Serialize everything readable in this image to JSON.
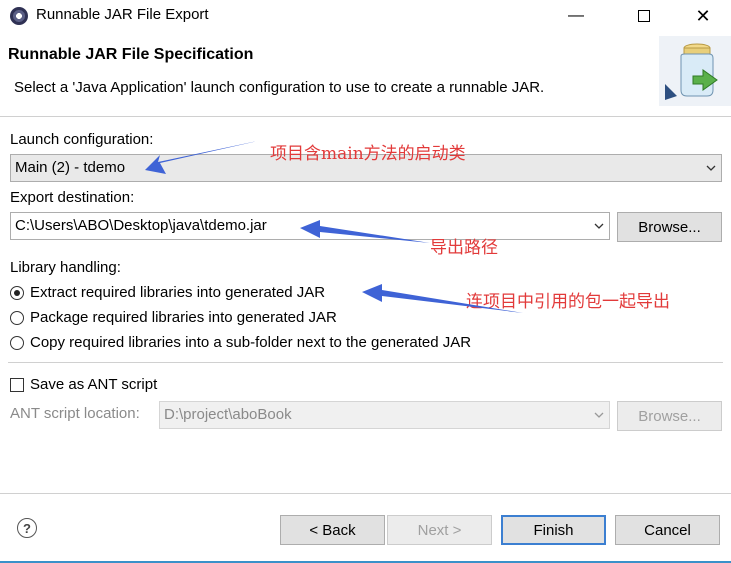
{
  "window": {
    "title": "Runnable JAR File Export",
    "minimize_icon": "minimize-icon",
    "maximize_icon": "maximize-icon",
    "close_icon": "close-icon"
  },
  "header": {
    "title": "Runnable JAR File Specification",
    "description": "Select a 'Java Application' launch configuration to use to create a runnable JAR."
  },
  "launch": {
    "label": "Launch configuration:",
    "value": "Main (2) - tdemo"
  },
  "export": {
    "label": "Export destination:",
    "value": "C:\\Users\\ABO\\Desktop\\java\\tdemo.jar",
    "browse_label": "Browse..."
  },
  "library": {
    "label": "Library handling:",
    "options": [
      {
        "label": "Extract required libraries into generated JAR",
        "selected": true
      },
      {
        "label": "Package required libraries into generated JAR",
        "selected": false
      },
      {
        "label": "Copy required libraries into a sub-folder next to the generated JAR",
        "selected": false
      }
    ]
  },
  "ant": {
    "checkbox_label": "Save as ANT script",
    "checked": false,
    "location_label": "ANT script location:",
    "location_value": "D:\\project\\aboBook",
    "browse_label": "Browse..."
  },
  "footer": {
    "help": "?",
    "back_label": "< Back",
    "next_label": "Next >",
    "finish_label": "Finish",
    "cancel_label": "Cancel"
  },
  "annotations": {
    "launch_note": "项目含main方法的启动类",
    "export_note": "导出路径",
    "library_note": "连项目中引用的包一起导出",
    "color": "#e23a3a",
    "arrow_color": "#3f63d6"
  }
}
